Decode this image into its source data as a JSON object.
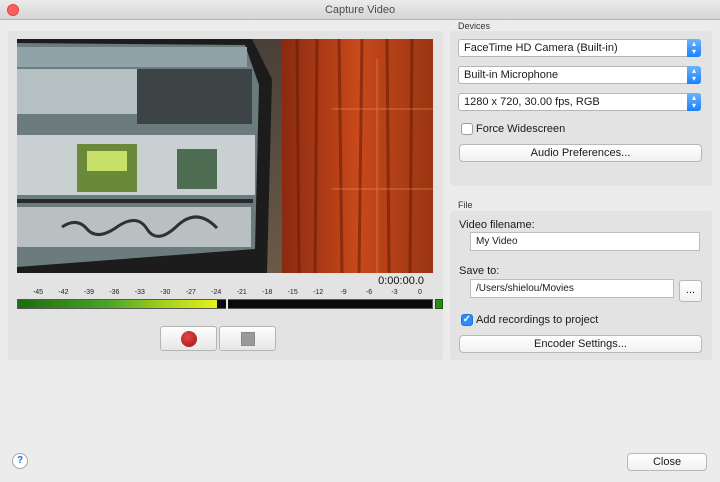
{
  "window": {
    "title": "Capture Video"
  },
  "capture": {
    "timecode": "0:00:00.0",
    "meter_ticks": [
      "-45",
      "-42",
      "-39",
      "-36",
      "-33",
      "-30",
      "-27",
      "-24",
      "-21",
      "-18",
      "-15",
      "-12",
      "-9",
      "-6",
      "-3",
      "0"
    ],
    "meter_level_db": -24,
    "peak_db": -23,
    "record_icon": "record-icon",
    "stop_icon": "stop-icon"
  },
  "devices": {
    "section_label": "Devices",
    "camera": "FaceTime HD Camera (Built-in)",
    "microphone": "Built-in Microphone",
    "format": "1280 x 720, 30.00 fps, RGB",
    "force_widescreen_label": "Force Widescreen",
    "force_widescreen_checked": false,
    "audio_prefs_label": "Audio Preferences..."
  },
  "file": {
    "section_label": "File",
    "filename_label": "Video filename:",
    "filename_value": "My Video",
    "save_to_label": "Save to:",
    "save_to_value": "/Users/shielou/Movies",
    "browse_label": "...",
    "add_to_project_label": "Add recordings to project",
    "add_to_project_checked": true,
    "encoder_label": "Encoder Settings..."
  },
  "footer": {
    "help_label": "?",
    "close_label": "Close"
  },
  "colors": {
    "accent": "#2d8cf8",
    "record": "#b01c1c",
    "meter_green": "#4ca327"
  }
}
